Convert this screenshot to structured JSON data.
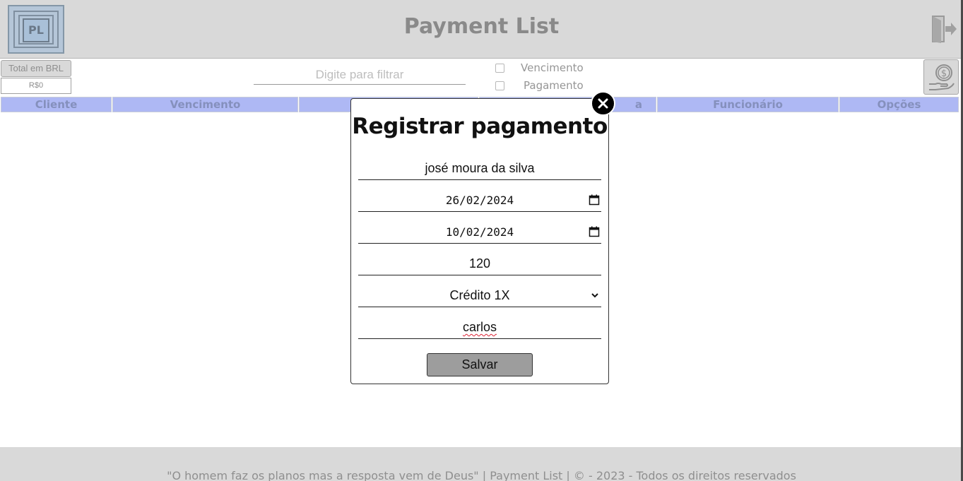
{
  "header": {
    "title": "Payment List",
    "logo_text": "PL",
    "logo_icon": "payment-list-logo",
    "exit_icon": "logout-icon"
  },
  "toolbar": {
    "total_label": "Total em BRL",
    "total_value": "R$0",
    "filter_placeholder": "Digite para filtrar",
    "checkbox_vencimento": "Vencimento",
    "checkbox_pagamento": "Pagamento",
    "money_icon": "money-hand-icon"
  },
  "table": {
    "columns": [
      "Cliente",
      "Vencimento",
      "",
      "",
      "a",
      "Funcionário",
      "Opções"
    ]
  },
  "modal": {
    "title": "Registrar pagamento",
    "client_name": "josé moura da silva",
    "due_date": "26/02/2024",
    "payment_date": "10/02/2024",
    "amount": "120",
    "payment_method": "Crédito 1X",
    "employee": "carlos",
    "save_label": "Salvar",
    "close_icon": "close-icon"
  },
  "footer": {
    "text": "\"O homem faz os planos mas a resposta vem de Deus\" | Payment List | © - 2023 - Todos os direitos reservados"
  },
  "colors": {
    "header_bg": "#d9d9d9",
    "table_header_bg": "#aeb8f4",
    "save_button_bg": "#9d9d9d"
  }
}
